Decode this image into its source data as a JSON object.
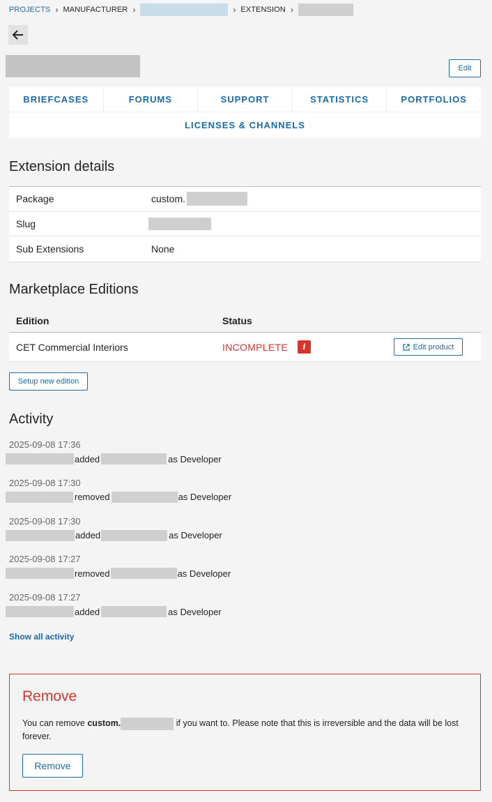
{
  "breadcrumb": {
    "projects": "Projects",
    "manufacturer": "Manufacturer",
    "extension": "Extension"
  },
  "header": {
    "edit_label": "Edit"
  },
  "tabs": {
    "row1": [
      "Briefcases",
      "Forums",
      "Support",
      "Statistics",
      "Portfolios"
    ],
    "row2": "Licenses & Channels"
  },
  "details": {
    "heading": "Extension details",
    "package_label": "Package",
    "package_value": "custom.",
    "slug_label": "Slug",
    "sub_label": "Sub Extensions",
    "sub_value": "None"
  },
  "editions": {
    "heading": "Marketplace Editions",
    "col_edition": "Edition",
    "col_status": "Status",
    "row_name": "CET Commercial Interiors",
    "row_status": "INCOMPLETE",
    "info_badge": "i",
    "edit_product_label": "Edit product",
    "setup_label": "Setup new edition",
    "status_color": "#d9342b"
  },
  "activity": {
    "heading": "Activity",
    "items": [
      {
        "time": "2025-09-08 17:36",
        "verb": "added",
        "role": "as Developer"
      },
      {
        "time": "2025-09-08 17:30",
        "verb": "removed",
        "role": "as Developer"
      },
      {
        "time": "2025-09-08 17:30",
        "verb": "added",
        "role": "as Developer"
      },
      {
        "time": "2025-09-08 17:27",
        "verb": "removed",
        "role": "as Developer"
      },
      {
        "time": "2025-09-08 17:27",
        "verb": "added",
        "role": "as Developer"
      }
    ],
    "show_all": "Show all activity"
  },
  "remove": {
    "title": "Remove",
    "text_before": "You can remove ",
    "package_bold": "custom.",
    "text_after": " if you want to. Please note that this is irreversible and the data will be lost forever.",
    "button_label": "Remove"
  },
  "colors": {
    "accent": "#1a6bab",
    "danger": "#d9342b",
    "background": "#f4f4f4"
  }
}
